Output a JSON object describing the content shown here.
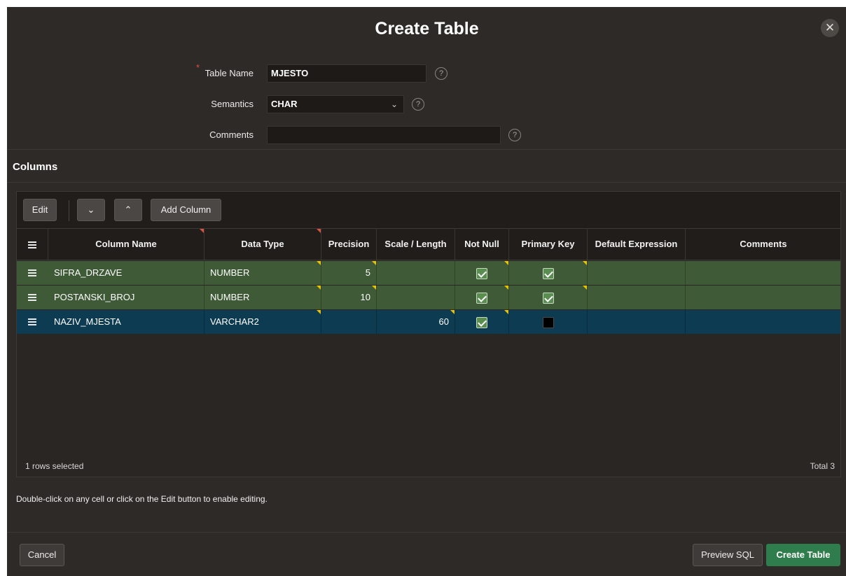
{
  "dialog": {
    "title": "Create Table",
    "close_glyph": "✕"
  },
  "form": {
    "table_name_label": "Table Name",
    "table_name_value": "MJESTO",
    "semantics_label": "Semantics",
    "semantics_value": "CHAR",
    "comments_label": "Comments",
    "comments_value": "",
    "required_mark": "*",
    "help_glyph": "?"
  },
  "columns_section": {
    "title": "Columns"
  },
  "toolbar": {
    "edit_label": "Edit",
    "move_down_glyph": "⌄",
    "move_up_glyph": "⌃",
    "add_column_label": "Add Column"
  },
  "grid": {
    "headers": [
      "Column Name",
      "Data Type",
      "Precision",
      "Scale / Length",
      "Not Null",
      "Primary Key",
      "Default Expression",
      "Comments"
    ],
    "rows": [
      {
        "name": "SIFRA_DRZAVE",
        "type": "NUMBER",
        "precision": "5",
        "scale": "",
        "not_null": true,
        "primary_key": true,
        "default": "",
        "comments": "",
        "state": "green"
      },
      {
        "name": "POSTANSKI_BROJ",
        "type": "NUMBER",
        "precision": "10",
        "scale": "",
        "not_null": true,
        "primary_key": true,
        "default": "",
        "comments": "",
        "state": "green"
      },
      {
        "name": "NAZIV_MJESTA",
        "type": "VARCHAR2",
        "precision": "",
        "scale": "60",
        "not_null": true,
        "primary_key": false,
        "default": "",
        "comments": "",
        "state": "selected"
      }
    ],
    "footer_selected": "1 rows selected",
    "footer_total": "Total 3"
  },
  "hint": "Double-click on any cell or click on the Edit button to enable editing.",
  "buttons": {
    "cancel": "Cancel",
    "preview_sql": "Preview SQL",
    "create_table": "Create Table"
  },
  "colors": {
    "dialog_bg": "#2e2a27",
    "row_changed": "#3e5a36",
    "row_selected": "#0d3b51",
    "primary_button": "#2f7d4c",
    "required": "#e24a4a",
    "changed_marker": "#e8c400"
  }
}
